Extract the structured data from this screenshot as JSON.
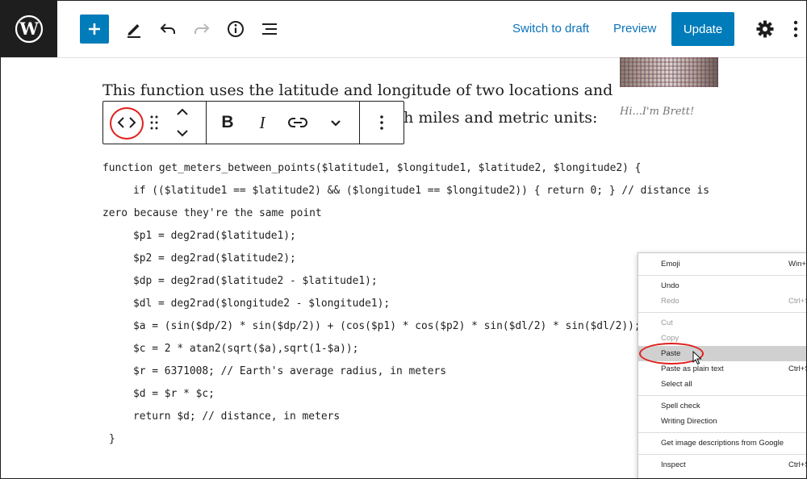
{
  "topbar": {
    "switch_to_draft": "Switch to draft",
    "preview": "Preview",
    "update": "Update"
  },
  "content": {
    "paragraph_line1": "This function uses the latitude and longitude of two locations and",
    "paragraph_line2_end": "oth miles and metric units:",
    "code": [
      "function get_meters_between_points($latitude1, $longitude1, $latitude2, $longitude2) {",
      "if (($latitude1 == $latitude2) && ($longitude1 == $longitude2)) { return 0; } // distance is",
      "zero because they're the same point",
      "$p1 = deg2rad($latitude1);",
      "$p2 = deg2rad($latitude2);",
      "$dp = deg2rad($latitude2 - $latitude1);",
      "$dl = deg2rad($longitude2 - $longitude1);",
      "$a = (sin($dp/2) * sin($dp/2)) + (cos($p1) * cos($p2) * sin($dl/2) * sin($dl/2));",
      "$c = 2 * atan2(sqrt($a),sqrt(1-$a));",
      "$r = 6371008; // Earth's average radius, in meters",
      "$d = $r * $c;",
      "return $d; // distance, in meters",
      "}"
    ]
  },
  "sidebar": {
    "caption": "Hi...I'm Brett!"
  },
  "block_toolbar": {
    "bold": "B",
    "italic": "I"
  },
  "context_menu": {
    "items": [
      {
        "label": "Emoji",
        "shortcut": "Win+"
      },
      {
        "label": "Undo",
        "shortcut": ""
      },
      {
        "label": "Redo",
        "shortcut": "Ctrl+S"
      },
      {
        "label": "Cut",
        "shortcut": ""
      },
      {
        "label": "Copy",
        "shortcut": ""
      },
      {
        "label": "Paste",
        "shortcut": ""
      },
      {
        "label": "Paste as plain text",
        "shortcut": "Ctrl+S"
      },
      {
        "label": "Select all",
        "shortcut": ""
      },
      {
        "label": "Spell check",
        "shortcut": ""
      },
      {
        "label": "Writing Direction",
        "shortcut": ""
      },
      {
        "label": "Get image descriptions from Google",
        "shortcut": ""
      },
      {
        "label": "Inspect",
        "shortcut": "Ctrl+S"
      }
    ]
  },
  "colors": {
    "accent": "#007cba",
    "highlight_circle": "#e0201b"
  }
}
